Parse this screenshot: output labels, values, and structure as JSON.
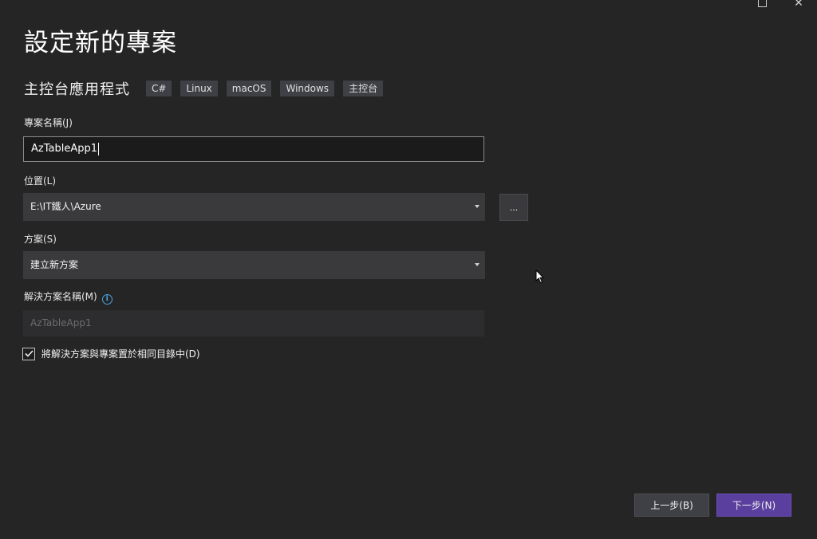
{
  "window": {
    "controls": {
      "close_glyph": "✕"
    }
  },
  "page_title": "設定新的專案",
  "template": {
    "name": "主控台應用程式",
    "tags": [
      "C#",
      "Linux",
      "macOS",
      "Windows",
      "主控台"
    ]
  },
  "form": {
    "project_name": {
      "label": "專案名稱(J)",
      "value": "AzTableApp1"
    },
    "location": {
      "label": "位置(L)",
      "value": "E:\\IT鐵人\\Azure",
      "browse_label": "..."
    },
    "solution": {
      "label": "方案(S)",
      "value": "建立新方案"
    },
    "solution_name": {
      "label": "解決方案名稱(M)",
      "info_glyph": "i",
      "value": "AzTableApp1"
    },
    "same_dir": {
      "label": "將解決方案與專案置於相同目錄中(D)",
      "checked": true
    }
  },
  "buttons": {
    "back": "上一步(B)",
    "next": "下一步(N)"
  },
  "colors": {
    "background": "#252526",
    "accent": "#5a3f9e",
    "info": "#4aa3df"
  }
}
